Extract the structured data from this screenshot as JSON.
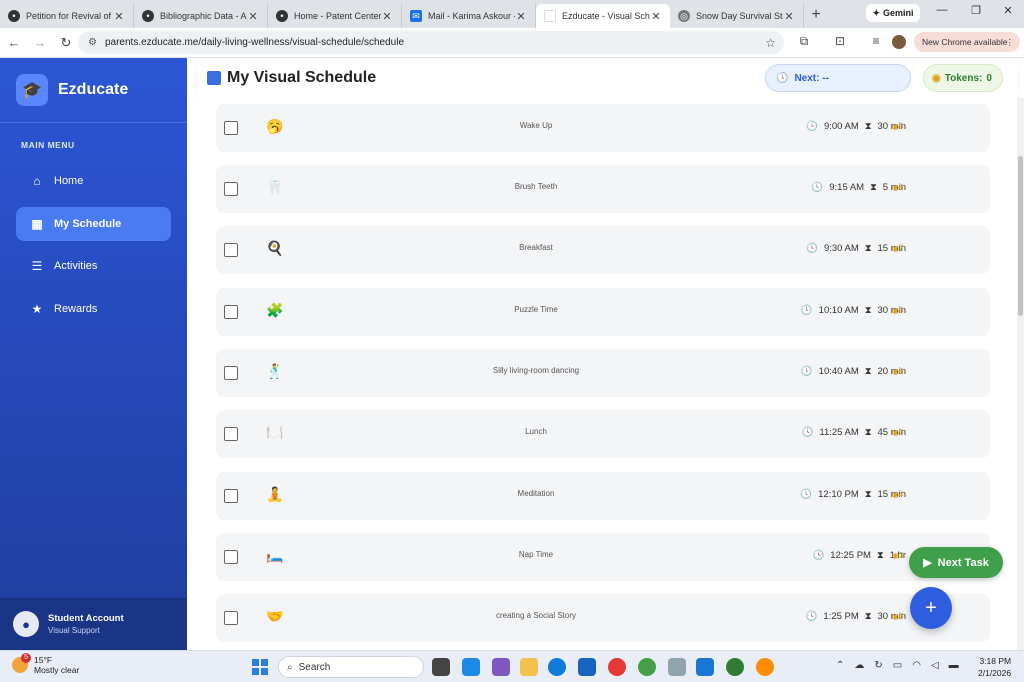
{
  "browser": {
    "tabs": [
      {
        "title": "Petition for Revival of an",
        "active": false
      },
      {
        "title": "Bibliographic Data - App",
        "active": false
      },
      {
        "title": "Home - Patent Center -",
        "active": false
      },
      {
        "title": "Mail - Karima Askour - C",
        "active": false
      },
      {
        "title": "Ezducate - Visual Sched",
        "active": true
      },
      {
        "title": "Snow Day Survival Startu",
        "active": false
      }
    ],
    "gemini_label": "Gemini",
    "url": "parents.ezducate.me/daily-living-wellness/visual-schedule/schedule",
    "new_chrome_label": "New Chrome available"
  },
  "sidebar": {
    "brand": "Ezducate",
    "menu_heading": "MAIN MENU",
    "items": [
      {
        "label": "Home",
        "icon": "home-icon",
        "active": false
      },
      {
        "label": "My Schedule",
        "icon": "calendar-icon",
        "active": true
      },
      {
        "label": "Activities",
        "icon": "list-icon",
        "active": false
      },
      {
        "label": "Rewards",
        "icon": "star-icon",
        "active": false
      }
    ],
    "account": {
      "name": "Student Account",
      "subtitle": "Visual Support"
    }
  },
  "header": {
    "title": "My Visual Schedule",
    "next_label": "Next: --",
    "tokens_label": "Tokens:",
    "tokens_value": "0"
  },
  "tasks": [
    {
      "emoji": "🥱",
      "name": "Wake Up",
      "time": "9:00 AM",
      "duration": "30 min",
      "tokens": "5"
    },
    {
      "emoji": "🦷",
      "name": "Brush Teeth",
      "time": "9:15 AM",
      "duration": "5 min",
      "tokens": "6"
    },
    {
      "emoji": "🍳",
      "name": "Breakfast",
      "time": "9:30 AM",
      "duration": "15 min",
      "tokens": "7"
    },
    {
      "emoji": "🧩",
      "name": "Puzzle Time",
      "time": "10:10 AM",
      "duration": "30 min",
      "tokens": "5"
    },
    {
      "emoji": "🕺",
      "name": "Silly living-room dancing",
      "time": "10:40 AM",
      "duration": "20 min",
      "tokens": "6"
    },
    {
      "emoji": "🍽️",
      "name": "Lunch",
      "time": "11:25 AM",
      "duration": "45 min",
      "tokens": "5"
    },
    {
      "emoji": "🧘",
      "name": "Meditation",
      "time": "12:10 PM",
      "duration": "15 min",
      "tokens": "4"
    },
    {
      "emoji": "🛏️",
      "name": "Nap Time",
      "time": "12:25 PM",
      "duration": "1 hr",
      "tokens": "3"
    },
    {
      "emoji": "🤝",
      "name": "creating a Social Story",
      "time": "1:25 PM",
      "duration": "30 min",
      "tokens": "6"
    }
  ],
  "actions": {
    "next_task_label": "Next Task",
    "add_label": "+"
  },
  "taskbar": {
    "weather_temp": "15°F",
    "weather_desc": "Mostly clear",
    "weather_badge": "5",
    "search_label": "Search",
    "time": "3:18 PM",
    "date": "2/1/2026"
  },
  "colors": {
    "sidebar": "#2d56d6",
    "accent": "#3b6fe0",
    "next_task": "#3f9f4a",
    "token": "#e0a21a"
  }
}
